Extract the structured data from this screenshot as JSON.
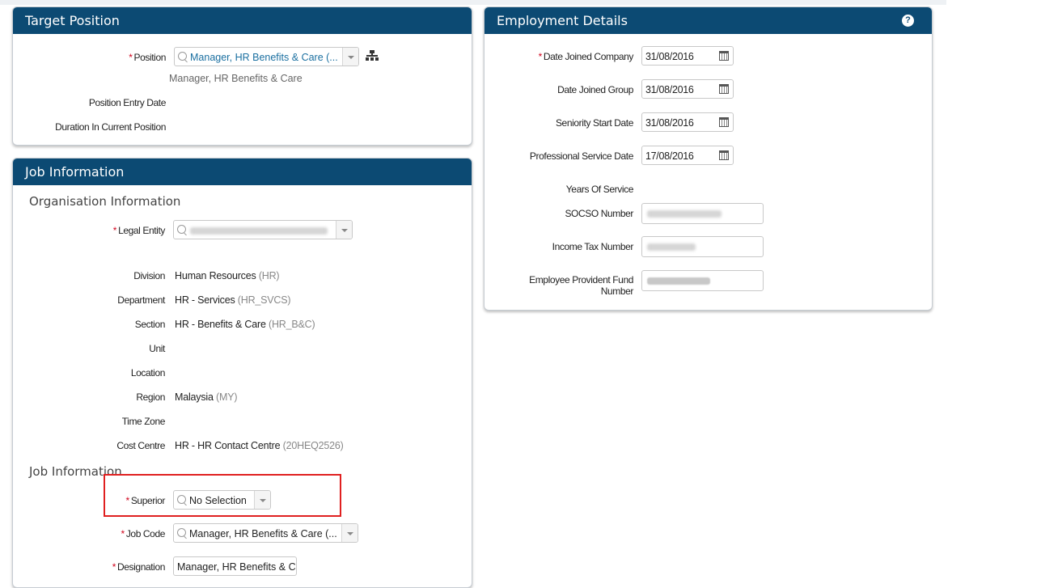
{
  "target_position": {
    "title": "Target Position",
    "position_label": "Position",
    "position_value": "Manager, HR Benefits & Care  (...",
    "position_subtext": "Manager, HR Benefits & Care",
    "position_entry_date_label": "Position Entry Date",
    "duration_label": "Duration In Current Position"
  },
  "job_information": {
    "title": "Job Information",
    "org_section": "Organisation Information",
    "legal_entity_label": "Legal Entity",
    "fields": [
      {
        "label": "Division",
        "value": "Human Resources",
        "code": "(HR)"
      },
      {
        "label": "Department",
        "value": "HR - Services",
        "code": "(HR_SVCS)"
      },
      {
        "label": "Section",
        "value": "HR - Benefits & Care",
        "code": "(HR_B&C)"
      },
      {
        "label": "Unit",
        "value": "",
        "code": ""
      },
      {
        "label": "Location",
        "value": "",
        "code": ""
      },
      {
        "label": "Region",
        "value": "Malaysia",
        "code": "(MY)"
      },
      {
        "label": "Time Zone",
        "value": "",
        "code": ""
      },
      {
        "label": "Cost Centre",
        "value": "HR - HR Contact Centre",
        "code": "(20HEQ2526)"
      }
    ],
    "job_section": "Job Information",
    "superior_label": "Superior",
    "superior_value": "No Selection",
    "job_code_label": "Job Code",
    "job_code_value": "Manager, HR Benefits & Care  (...",
    "designation_label": "Designation",
    "designation_value": "Manager, HR Benefits & Care"
  },
  "employment_details": {
    "title": "Employment Details",
    "help_icon": "?",
    "date_joined_company_label": "Date Joined Company",
    "date_joined_company": "31/08/2016",
    "date_joined_group_label": "Date Joined Group",
    "date_joined_group": "31/08/2016",
    "seniority_start_label": "Seniority Start Date",
    "seniority_start": "31/08/2016",
    "professional_service_label": "Professional Service Date",
    "professional_service": "17/08/2016",
    "years_of_service_label": "Years Of Service",
    "socso_label": "SOCSO Number",
    "income_tax_label": "Income Tax Number",
    "epf_label_line1": "Employee Provident Fund",
    "epf_label_line2": "Number"
  },
  "colors": {
    "header": "#0c4a73",
    "required": "#d0021b",
    "highlight": "#e02020"
  }
}
